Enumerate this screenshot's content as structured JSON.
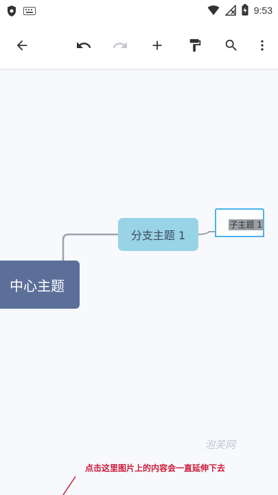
{
  "status_bar": {
    "time": "9:53",
    "left_icons": [
      "shield-icon",
      "keyboard-icon"
    ],
    "right_icons": [
      "wifi-icon",
      "no-signal-icon",
      "battery-icon"
    ]
  },
  "toolbar": {
    "buttons": [
      "back-arrow-icon",
      "undo-icon",
      "redo-icon",
      "add-icon",
      "format-painter-icon",
      "search-icon",
      "more-vert-icon"
    ],
    "redo_enabled": false
  },
  "mindmap": {
    "central_topic": "中心主题",
    "branch_topic": "分支主题 1",
    "sub_topic": "子主题 1",
    "central_color": "#5b6f99",
    "branch_color": "#98d3e6",
    "selection_color": "#4ab3e8"
  },
  "watermark": "泡芙网",
  "annotation": "点击这里图片上的内容会一直延伸下去"
}
